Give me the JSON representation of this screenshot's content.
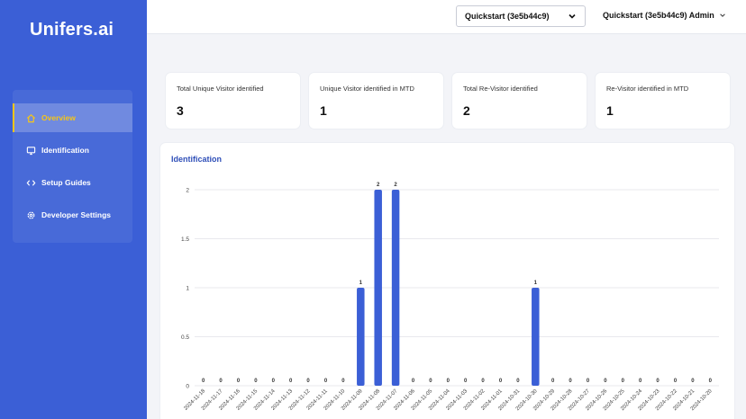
{
  "app": {
    "logo_text": "Unifers.ai"
  },
  "sidebar": {
    "items": [
      {
        "label": "Overview",
        "icon": "home-icon",
        "active": true
      },
      {
        "label": "Identification",
        "icon": "monitor-icon",
        "active": false
      },
      {
        "label": "Setup Guides",
        "icon": "code-icon",
        "active": false
      },
      {
        "label": "Developer Settings",
        "icon": "gear-icon",
        "active": false
      }
    ]
  },
  "header": {
    "workspace_selected": "Quickstart (3e5b44c9)",
    "user_label": "Quickstart (3e5b44c9) Admin"
  },
  "stats": [
    {
      "label": "Total Unique Visitor identified",
      "value": "3"
    },
    {
      "label": "Unique Visitor identified in MTD",
      "value": "1"
    },
    {
      "label": "Total Re-Visitor identified",
      "value": "2"
    },
    {
      "label": "Re-Visitor identified in MTD",
      "value": "1"
    }
  ],
  "panel": {
    "title": "Identification"
  },
  "colors": {
    "sidebar": "#3b5fd6",
    "accent": "#f5c518",
    "bar": "#3b5fd6",
    "title": "#2f4fb8"
  },
  "chart_data": {
    "type": "bar",
    "title": "Identification",
    "categories": [
      "2024-11-18",
      "2024-11-17",
      "2024-11-16",
      "2024-11-15",
      "2024-11-14",
      "2024-11-13",
      "2024-11-12",
      "2024-11-11",
      "2024-11-10",
      "2024-11-09",
      "2024-11-08",
      "2024-11-07",
      "2024-11-06",
      "2024-11-05",
      "2024-11-04",
      "2024-11-03",
      "2024-11-02",
      "2024-11-01",
      "2024-10-31",
      "2024-10-30",
      "2024-10-29",
      "2024-10-28",
      "2024-10-27",
      "2024-10-26",
      "2024-10-25",
      "2024-10-24",
      "2024-10-23",
      "2024-10-22",
      "2024-10-21",
      "2024-10-20"
    ],
    "values": [
      0,
      0,
      0,
      0,
      0,
      0,
      0,
      0,
      0,
      1,
      2,
      2,
      0,
      0,
      0,
      0,
      0,
      0,
      0,
      1,
      0,
      0,
      0,
      0,
      0,
      0,
      0,
      0,
      0,
      0
    ],
    "yticks": [
      "0",
      "0.5",
      "1",
      "1.5",
      "2"
    ],
    "ylim": [
      0,
      2
    ],
    "grid": true,
    "data_labels": true
  }
}
